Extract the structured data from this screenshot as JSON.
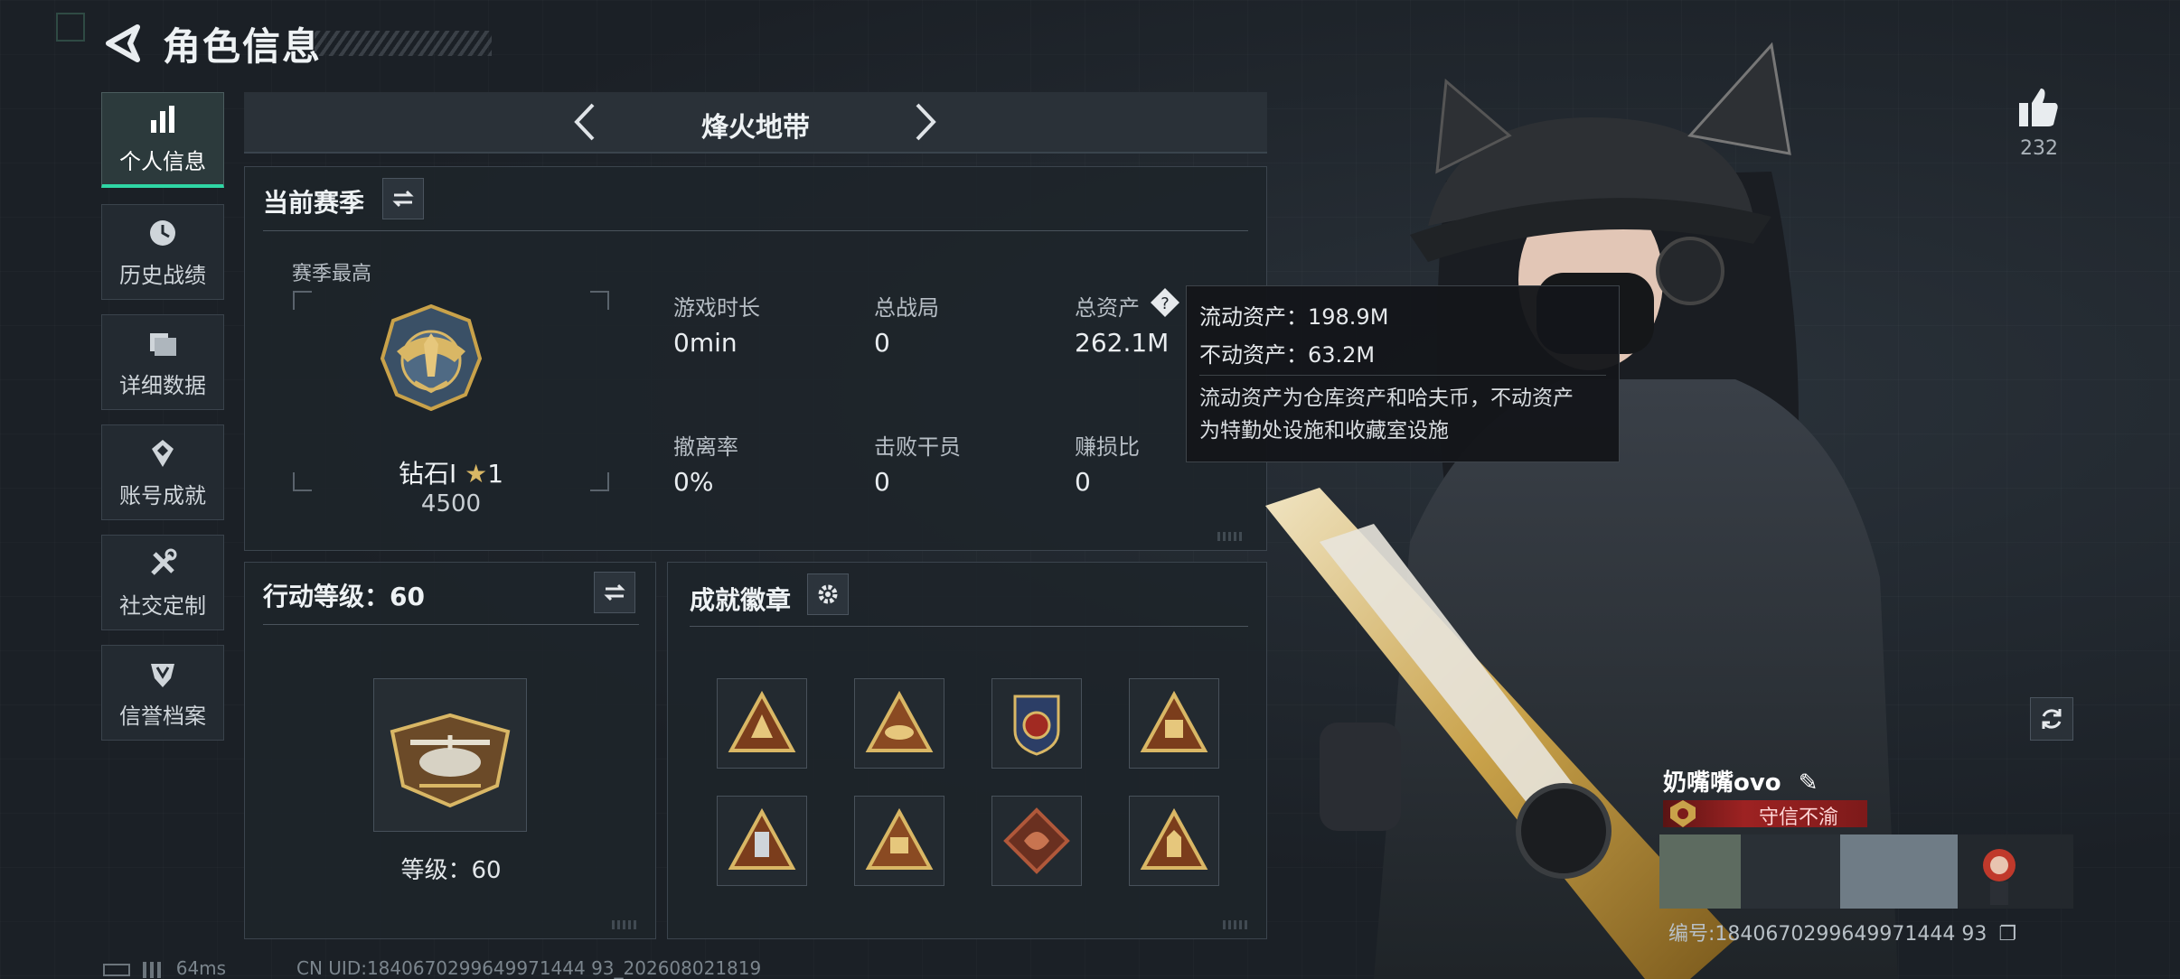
{
  "header": {
    "title": "角色信息"
  },
  "sidebar": {
    "items": [
      {
        "label": "个人信息",
        "icon": "bar-chart-icon",
        "active": true
      },
      {
        "label": "历史战绩",
        "icon": "clock-icon"
      },
      {
        "label": "详细数据",
        "icon": "folder-icon"
      },
      {
        "label": "账号成就",
        "icon": "achievement-icon"
      },
      {
        "label": "社交定制",
        "icon": "tools-icon"
      },
      {
        "label": "信誉档案",
        "icon": "shield-icon"
      }
    ]
  },
  "mode": {
    "title": "烽火地带"
  },
  "season": {
    "title": "当前赛季",
    "best_label": "赛季最高",
    "rank_name": "钻石Ⅰ",
    "rank_stars": "1",
    "rank_score": "4500",
    "stats": [
      {
        "label": "游戏时长",
        "value": "0min"
      },
      {
        "label": "总战局",
        "value": "0"
      },
      {
        "label": "总资产",
        "value": "262.1M"
      },
      {
        "label": "撤离率",
        "value": "0%"
      },
      {
        "label": "击败干员",
        "value": "0"
      },
      {
        "label": "赚损比",
        "value": "0"
      }
    ]
  },
  "tooltip": {
    "liquid": "流动资产：198.9M",
    "fixed": "不动资产：63.2M",
    "desc1": "流动资产为仓库资产和哈夫币，不动资产",
    "desc2": "为特勤处设施和收藏室设施"
  },
  "level": {
    "title": "行动等级：60",
    "caption": "等级：60"
  },
  "badges": {
    "title": "成就徽章",
    "items": [
      "badge-1",
      "badge-2",
      "badge-3",
      "badge-4",
      "badge-5",
      "badge-6",
      "badge-7",
      "badge-8"
    ]
  },
  "social": {
    "likes": "232"
  },
  "player": {
    "name": "奶嘴嘴ovo",
    "reputation": "守信不渝",
    "id": "编号:1840670299649971444 93"
  },
  "footer": {
    "ping": "64ms",
    "uid": "CN UID:1840670299649971444 93_202608021819"
  },
  "colors": {
    "accent": "#2fd6a4",
    "reputation": "#9d2222",
    "gold": "#c9a24a"
  }
}
